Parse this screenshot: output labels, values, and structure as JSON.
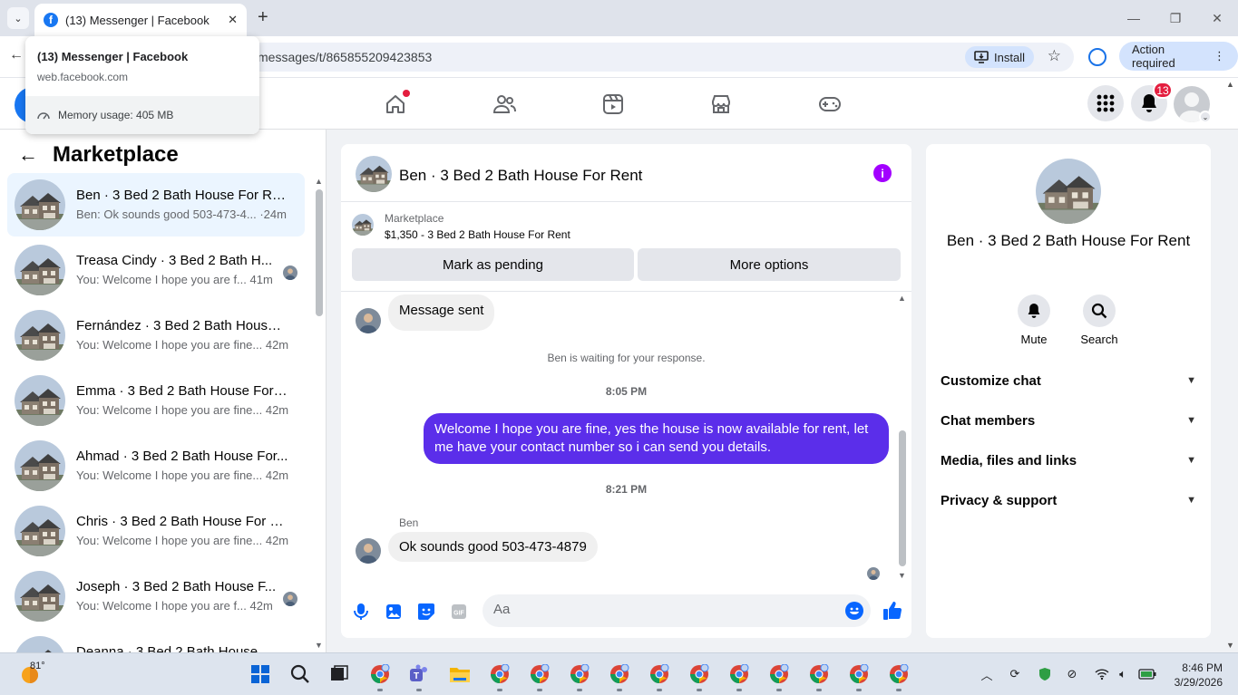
{
  "browser": {
    "tab_title": "(13) Messenger | Facebook",
    "url": "messages/t/865855209423853",
    "install_label": "Install",
    "action_label": "Action required",
    "hovercard": {
      "title": "(13) Messenger | Facebook",
      "domain": "web.facebook.com",
      "memory": "Memory usage: 405 MB"
    }
  },
  "header": {
    "notification_count": "13"
  },
  "sidebar": {
    "title": "Marketplace",
    "chats": [
      {
        "name": "Ben · 3 Bed 2 Bath House For Rent",
        "preview": "Ben: Ok sounds good 503-473-4... ·24m",
        "active": true
      },
      {
        "name": "Treasa Cindy · 3 Bed 2 Bath H...",
        "preview": "You: Welcome I hope you are f...  41m"
      },
      {
        "name": "Fernández · 3 Bed 2 Bath House ...",
        "preview": "You: Welcome I hope you are fine...  42m"
      },
      {
        "name": "Emma · 3 Bed 2 Bath House For ...",
        "preview": "You: Welcome I hope you are fine...  42m"
      },
      {
        "name": "Ahmad · 3 Bed 2 Bath House For...",
        "preview": "You: Welcome I hope you are fine...  42m"
      },
      {
        "name": "Chris · 3 Bed 2 Bath House For R...",
        "preview": "You: Welcome I hope you are fine...  42m"
      },
      {
        "name": "Joseph · 3 Bed 2 Bath House F...",
        "preview": "You: Welcome I hope you are f...  42m"
      },
      {
        "name": "Deanna · 3 Bed 2 Bath House",
        "preview": ""
      }
    ]
  },
  "conversation": {
    "title": "Ben · 3 Bed 2 Bath House For Rent",
    "marketplace_label": "Marketplace",
    "listing": "$1,350 - 3 Bed 2 Bath House For Rent",
    "mark_pending": "Mark as pending",
    "more_options": "More options",
    "msg_sent": "Message sent",
    "waiting": "Ben is waiting for your response.",
    "time1": "8:05 PM",
    "outgoing": "Welcome I hope you are fine, yes the house is now available for rent, let me have your contact number so i can send you  details.",
    "time2": "8:21 PM",
    "sender": "Ben",
    "incoming": "Ok sounds good 503-473-4879",
    "composer_placeholder": "Aa"
  },
  "right_panel": {
    "name": "Ben · 3 Bed 2 Bath House For Rent",
    "mute": "Mute",
    "search": "Search",
    "rows": [
      "Customize chat",
      "Chat members",
      "Media, files and links",
      "Privacy & support"
    ]
  },
  "taskbar": {
    "temp": "81°",
    "time": "8:46 PM",
    "date": "3/29/2026"
  },
  "colors": {
    "facebook_blue": "#1877f2",
    "outgoing_bubble": "#5b2eea",
    "badge_red": "#e41e3f"
  }
}
